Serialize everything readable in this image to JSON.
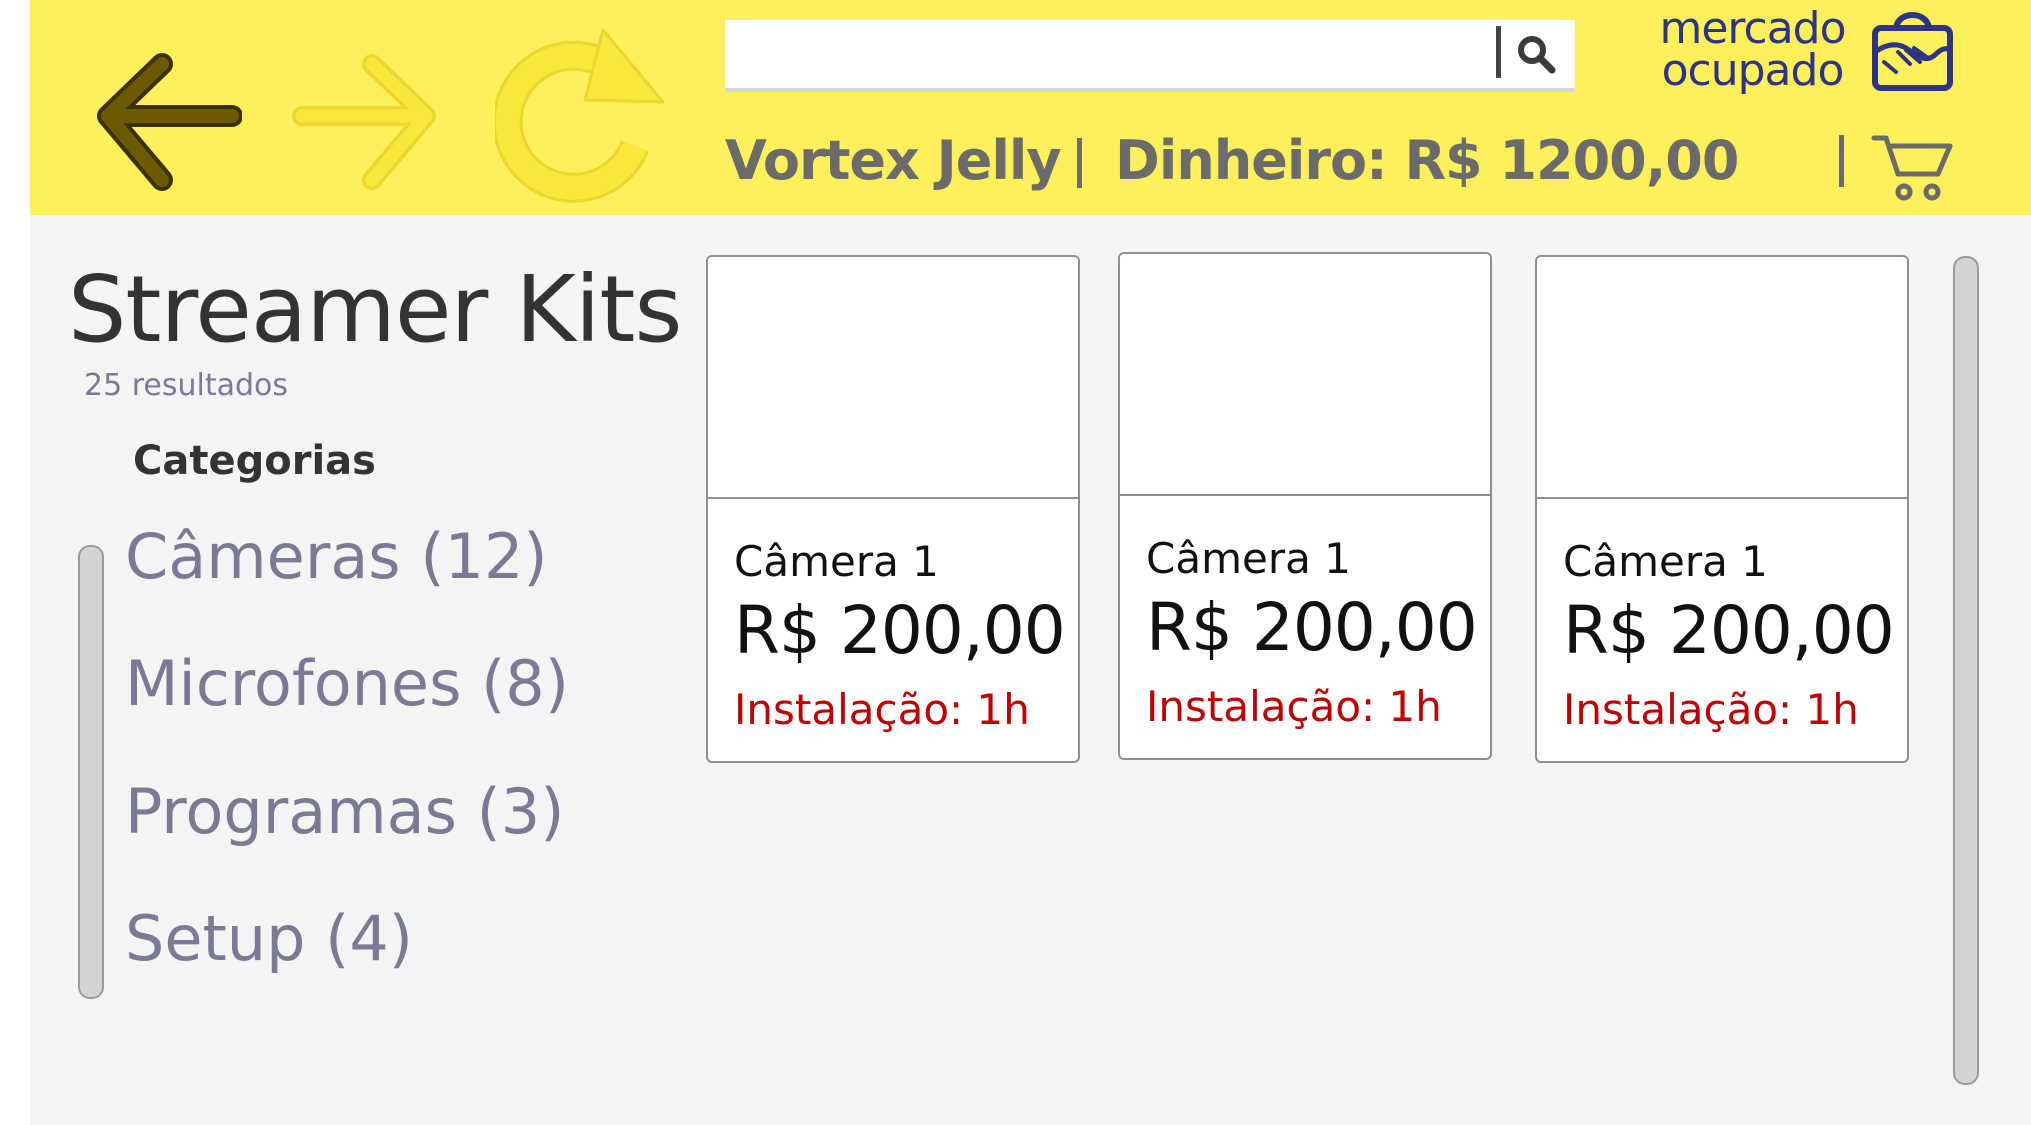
{
  "header": {
    "search": {
      "value": "",
      "placeholder": ""
    },
    "logo": {
      "line1": "mercado",
      "line2": "ocupado"
    },
    "user_name": "Vortex Jelly",
    "money": "Dinheiro: R$ 1200,00",
    "colors": {
      "topbar": "#fef05a",
      "logo_blue": "#2d3486",
      "back_arrow": "#6b5a00",
      "inactive_arrow": "#fbe73c"
    }
  },
  "nav": {
    "back_icon": "arrow-left-icon",
    "forward_icon": "arrow-right-icon",
    "reload_icon": "reload-icon"
  },
  "page": {
    "title": "Streamer Kits",
    "results": "25 resultados",
    "categories_heading": "Categorias"
  },
  "categories": [
    {
      "label": "Câmeras (12)"
    },
    {
      "label": "Microfones (8)"
    },
    {
      "label": "Programas (3)"
    },
    {
      "label": "Setup (4)"
    }
  ],
  "products": [
    {
      "name": "Câmera 1",
      "price": "R$ 200,00",
      "install": "Instalação: 1h"
    },
    {
      "name": "Câmera 1",
      "price": "R$ 200,00",
      "install": "Instalação: 1h"
    },
    {
      "name": "Câmera 1",
      "price": "R$ 200,00",
      "install": "Instalação: 1h"
    }
  ]
}
